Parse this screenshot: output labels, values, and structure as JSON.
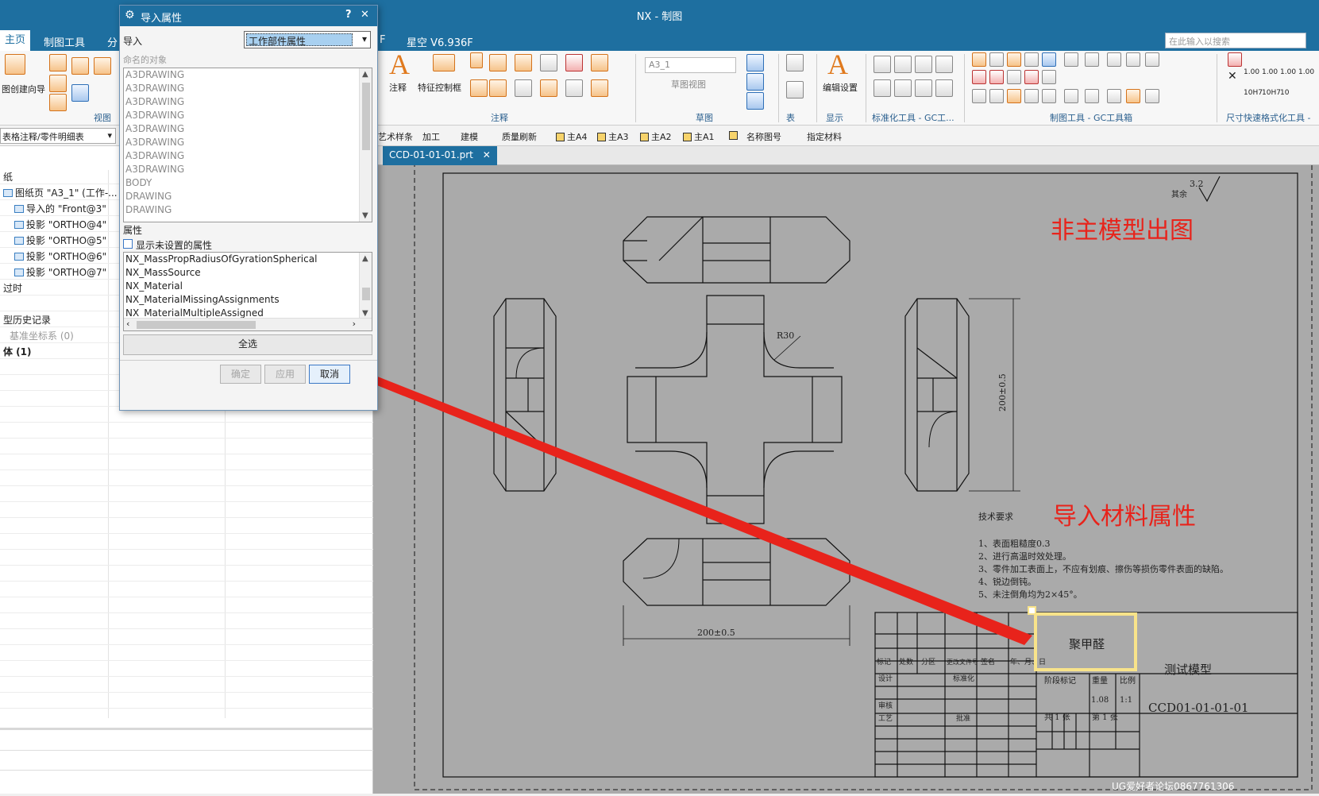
{
  "app": {
    "title": "NX - 制图",
    "quick_toolbar_text": "星空 V6.936F"
  },
  "tabs": [
    {
      "label": "主页"
    },
    {
      "label": "制图工具"
    },
    {
      "label": "分"
    },
    {
      "label": "F"
    }
  ],
  "search": {
    "placeholder": "在此输入以搜索"
  },
  "ribbon": {
    "left_labels": {
      "wizard": "图创建向导",
      "view_group": "视图"
    },
    "annotation": {
      "note": "注释",
      "feature_frame": "特征控制框",
      "group": "注释"
    },
    "sketch": {
      "view_select": "A3_1",
      "sketch_view": "草图视图",
      "group": "草图"
    },
    "table_group": "表",
    "edit_settings": "编辑设置",
    "display_group": "显示",
    "std_group": "标准化工具 - GC工...",
    "drafting_group": "制图工具 - GC工具箱",
    "dim_group": "尺寸快速格式化工具 -",
    "dim_values": [
      "1.00",
      "1.00",
      "1.00",
      "1.00"
    ],
    "tolerance_codes": [
      "10H7",
      "10H7",
      "10"
    ]
  },
  "toolbar2": {
    "filter": "表格注释/零件明细表",
    "items": [
      "艺术样条",
      "加工",
      "建模",
      "质量刷新",
      "主A4",
      "主A3",
      "主A2",
      "主A1",
      "名称图号",
      "指定材料"
    ]
  },
  "navigator": {
    "rows": [
      "纸",
      "图纸页 \"A3_1\" (工作-...",
      "导入的 \"Front@3\"",
      "投影 \"ORTHO@4\"",
      "投影 \"ORTHO@5\"",
      "投影 \"ORTHO@6\"",
      "投影 \"ORTHO@7\"",
      "过时",
      "",
      "型历史记录",
      "基准坐标系 (0)",
      "体 (1)"
    ]
  },
  "document_tab": {
    "label": "CCD-01-01-01.prt"
  },
  "dialog": {
    "title": "导入属性",
    "help": "?",
    "close": "✕",
    "import_label": "导入",
    "import_value": "工作部件属性",
    "named_objects_label": "命名的对象",
    "named_objects": [
      "A3DRAWING",
      "A3DRAWING",
      "A3DRAWING",
      "A3DRAWING",
      "A3DRAWING",
      "A3DRAWING",
      "A3DRAWING",
      "A3DRAWING",
      "BODY",
      "DRAWING",
      "DRAWING"
    ],
    "attributes_label": "属性",
    "show_unset_label": "显示未设置的属性",
    "attributes": [
      "NX_MassPropRadiusOfGyrationSpherical",
      "NX_MassSource",
      "NX_Material",
      "NX_MaterialMissingAssignments",
      "NX_MaterialMultipleAssigned"
    ],
    "select_all": "全选",
    "ok": "确定",
    "apply": "应用",
    "cancel": "取消"
  },
  "drawing": {
    "roughness": "3.2",
    "roughness_note": "其余",
    "radius_label": "R30",
    "height_dim": "200±0.5",
    "width_dim": "200±0.5",
    "tech_title": "技术要求",
    "tech_notes": [
      "1、表面粗糙度0.3",
      "2、进行高温时效处理。",
      "3、零件加工表面上，不应有划痕、擦伤等损伤零件表面的缺陷。",
      "4、锐边倒钝。",
      "5、未注倒角均为2×45°。"
    ],
    "material": "聚甲醛",
    "part_name": "测试模型",
    "part_number": "CCD01-01-01-01",
    "title_block": {
      "row_labels": [
        "标记",
        "处数",
        "分区",
        "更改文件号",
        "签名",
        "年、月、日"
      ],
      "design": "设计",
      "standardize": "标准化",
      "review": "审核",
      "process": "工艺",
      "approve": "批准",
      "stage_mark": "阶段标记",
      "weight": "重量",
      "scale": "比例",
      "weight_value": "1.08",
      "scale_value": "1:1",
      "sheets_total": "共 1 张",
      "sheet_no": "第 1 张"
    },
    "annotation_top": "非主模型出图",
    "annotation_bottom": "导入材料属性",
    "arrow_color": "#e8231b"
  },
  "watermark": "UG爱好者论坛0867761306"
}
